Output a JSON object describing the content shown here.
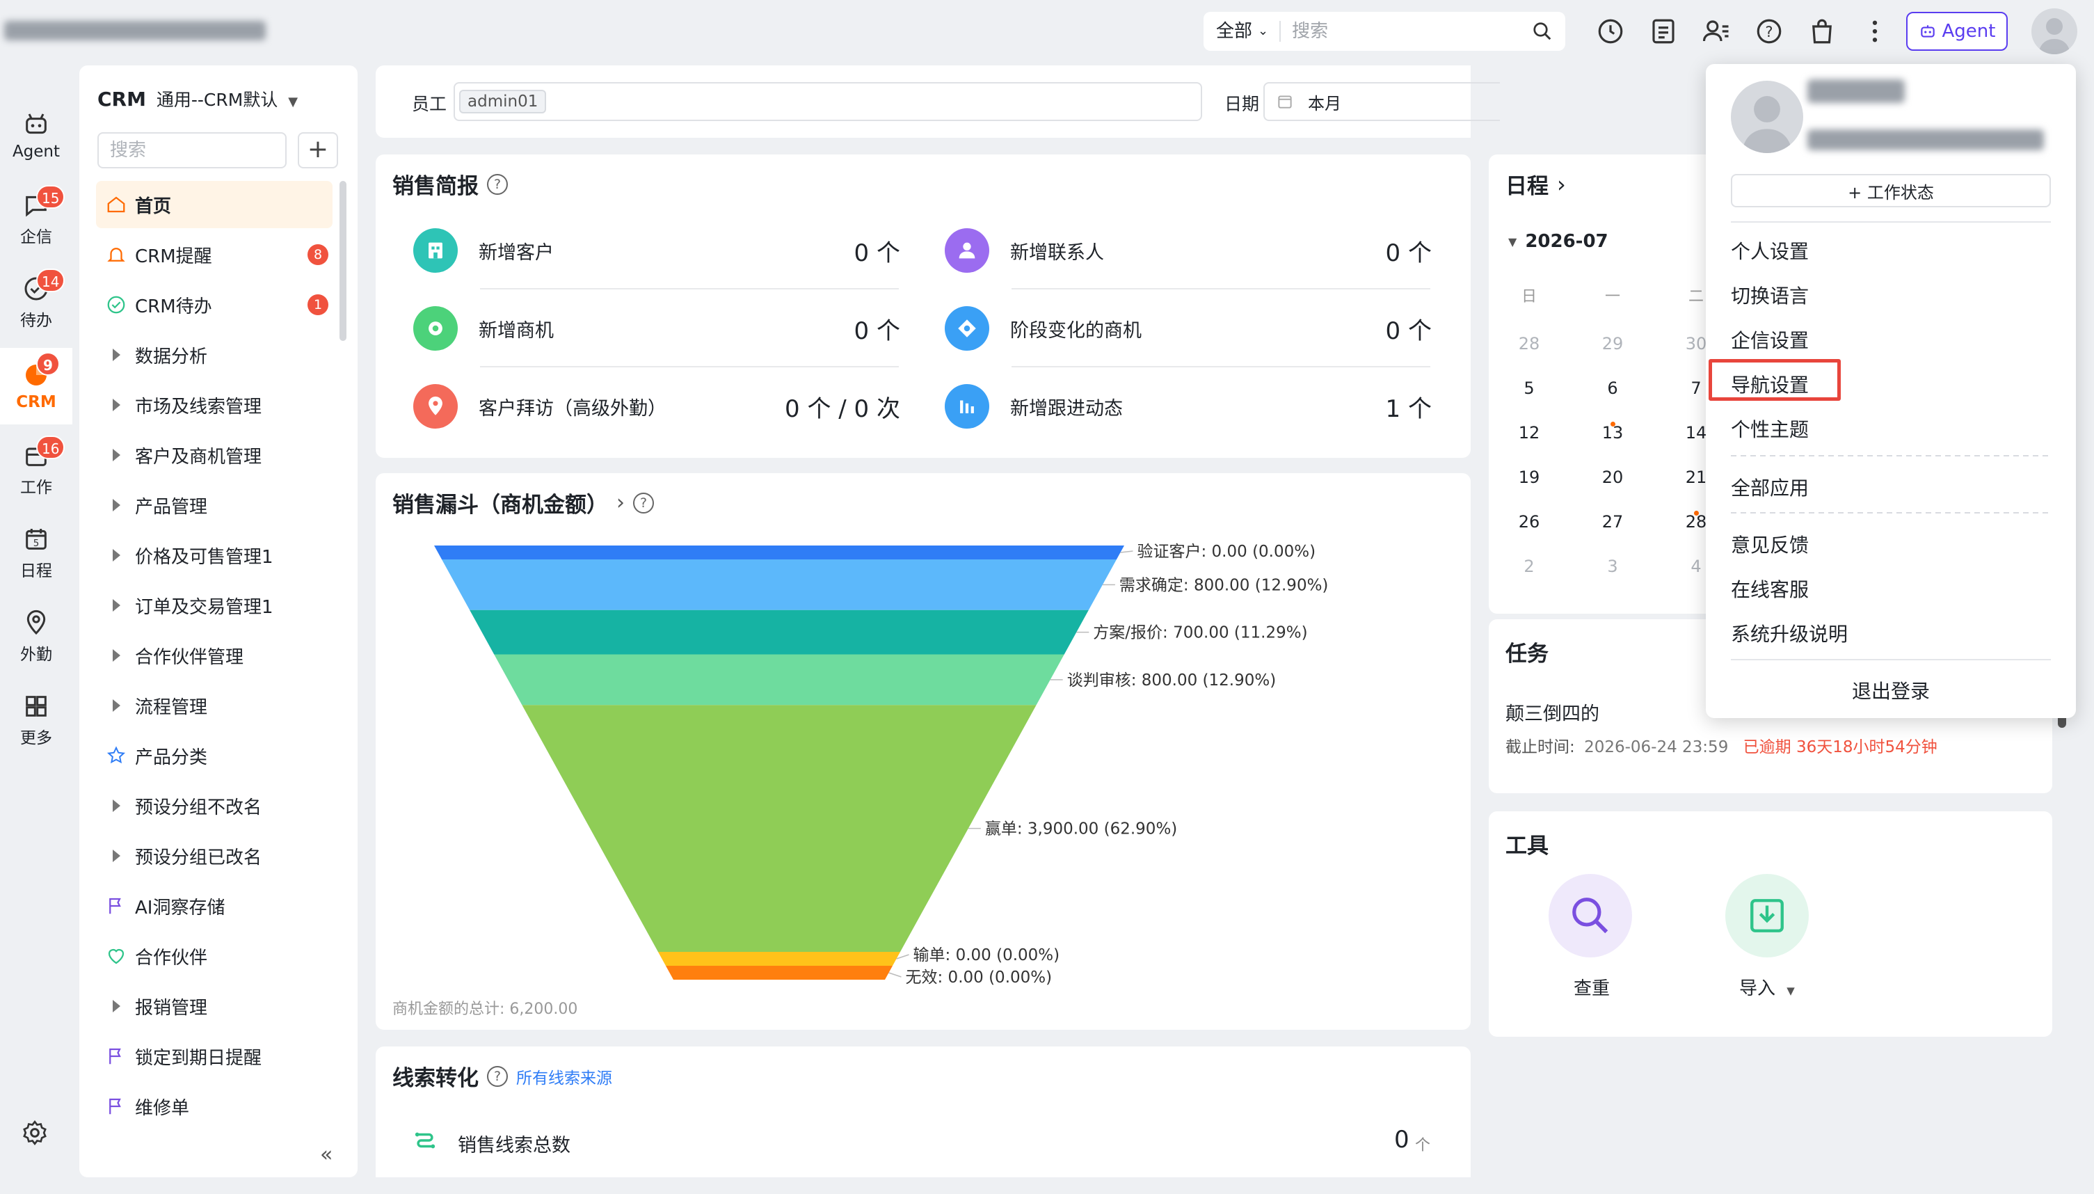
{
  "topbar": {
    "brand": "企业CRM",
    "search_scope": "全部",
    "search_placeholder": "搜索",
    "agent_label": "Agent",
    "icons": [
      "clock-icon",
      "report-icon",
      "contacts-icon",
      "help-icon",
      "bag-icon",
      "more-icon"
    ]
  },
  "rail": {
    "items": [
      {
        "label": "Agent",
        "icon": "agent-icon",
        "badge": ""
      },
      {
        "label": "企信",
        "icon": "chat-icon",
        "badge": "15"
      },
      {
        "label": "待办",
        "icon": "todo-icon",
        "badge": "14"
      },
      {
        "label": "CRM",
        "icon": "crm-icon",
        "badge": "9"
      },
      {
        "label": "工作",
        "icon": "work-icon",
        "badge": "16"
      },
      {
        "label": "日程",
        "icon": "calendar-icon",
        "badge": ""
      },
      {
        "label": "外勤",
        "icon": "location-icon",
        "badge": ""
      },
      {
        "label": "更多",
        "icon": "grid-icon",
        "badge": ""
      }
    ],
    "settings_icon": "gear-icon"
  },
  "sidebar": {
    "title_bold": "CRM",
    "title_rest": "通用--CRM默认",
    "search_placeholder": "搜索",
    "add_label": "+",
    "items": [
      {
        "label": "首页",
        "icon": "home-icon",
        "badge": "",
        "active": true
      },
      {
        "label": "CRM提醒",
        "icon": "bell-icon",
        "badge": "8"
      },
      {
        "label": "CRM待办",
        "icon": "check-circle-icon",
        "badge": "1"
      },
      {
        "label": "数据分析",
        "icon": "caret-right-icon"
      },
      {
        "label": "市场及线索管理",
        "icon": "caret-right-icon"
      },
      {
        "label": "客户及商机管理",
        "icon": "caret-right-icon"
      },
      {
        "label": "产品管理",
        "icon": "caret-right-icon"
      },
      {
        "label": "价格及可售管理1",
        "icon": "caret-right-icon"
      },
      {
        "label": "订单及交易管理1",
        "icon": "caret-right-icon"
      },
      {
        "label": "合作伙伴管理",
        "icon": "caret-right-icon"
      },
      {
        "label": "流程管理",
        "icon": "caret-right-icon"
      },
      {
        "label": "产品分类",
        "icon": "star-icon"
      },
      {
        "label": "预设分组不改名",
        "icon": "caret-right-icon"
      },
      {
        "label": "预设分组已改名",
        "icon": "caret-right-icon"
      },
      {
        "label": "AI洞察存储",
        "icon": "flag-icon"
      },
      {
        "label": "合作伙伴",
        "icon": "heart-icon"
      },
      {
        "label": "报销管理",
        "icon": "caret-right-icon"
      },
      {
        "label": "锁定到期日提醒",
        "icon": "flag-icon"
      },
      {
        "label": "维修单",
        "icon": "flag-icon"
      }
    ],
    "collapse_icon": "double-chevron-left-icon"
  },
  "filter": {
    "employee_label": "员工",
    "employee_tag": "admin01",
    "date_label": "日期",
    "date_value": "本月"
  },
  "sales_brief": {
    "title": "销售简报",
    "items": [
      {
        "label": "新增客户",
        "value": "0 个",
        "color": "#2ec4b6",
        "icon": "building-icon"
      },
      {
        "label": "新增联系人",
        "value": "0 个",
        "color": "#9b6cf0",
        "icon": "person-icon"
      },
      {
        "label": "新增商机",
        "value": "0 个",
        "color": "#4cd27a",
        "icon": "target-icon"
      },
      {
        "label": "阶段变化的商机",
        "value": "0 个",
        "color": "#3aa0f5",
        "icon": "stage-icon"
      },
      {
        "label": "客户拜访（高级外勤）",
        "value": "0 个 / 0 次",
        "color": "#f46a5a",
        "icon": "pin-icon"
      },
      {
        "label": "新增跟进动态",
        "value": "1 个",
        "color": "#3aa0f5",
        "icon": "bars-icon"
      }
    ]
  },
  "funnel": {
    "title": "销售漏斗（商机金额）",
    "total_text": "商机金额的总计: 6,200.00",
    "stages": [
      {
        "label": "验证客户: 0.00 (0.00%)",
        "color": "#2f7df6"
      },
      {
        "label": "需求确定: 800.00 (12.90%)",
        "color": "#5cb8fb"
      },
      {
        "label": "方案/报价: 700.00 (11.29%)",
        "color": "#16b3a3"
      },
      {
        "label": "谈判审核: 800.00 (12.90%)",
        "color": "#6edc9e"
      },
      {
        "label": "赢单: 3,900.00 (62.90%)",
        "color": "#8fcd56"
      },
      {
        "label": "输单: 0.00 (0.00%)",
        "color": "#ffc21a"
      },
      {
        "label": "无效: 0.00 (0.00%)",
        "color": "#ff7f0e"
      }
    ]
  },
  "chart_data": {
    "type": "funnel",
    "title": "销售漏斗（商机金额）",
    "categories": [
      "验证客户",
      "需求确定",
      "方案/报价",
      "谈判审核",
      "赢单",
      "输单",
      "无效"
    ],
    "values": [
      0,
      800,
      700,
      800,
      3900,
      0,
      0
    ],
    "percent": [
      0.0,
      12.9,
      11.29,
      12.9,
      62.9,
      0.0,
      0.0
    ],
    "total": 6200
  },
  "lead_conversion": {
    "title": "线索转化",
    "link": "所有线索来源",
    "metric_label": "销售线索总数",
    "metric_value": "0",
    "metric_unit": "个"
  },
  "schedule": {
    "title": "日程",
    "month": "2026-07",
    "weekdays": [
      "日",
      "一",
      "二"
    ],
    "rows": [
      [
        "28",
        "29",
        "30"
      ],
      [
        "5",
        "6",
        "7"
      ],
      [
        "12",
        "13",
        "14"
      ],
      [
        "19",
        "20",
        "21"
      ],
      [
        "26",
        "27",
        "28"
      ],
      [
        "2",
        "3",
        "4"
      ]
    ]
  },
  "tasks": {
    "title": "任务",
    "task_name": "颠三倒四的",
    "deadline_label": "截止时间:",
    "deadline": "2026-06-24 23:59",
    "overdue": "已逾期 36天18小时54分钟"
  },
  "tools": {
    "title": "工具",
    "items": [
      {
        "label": "查重",
        "icon": "search-icon"
      },
      {
        "label": "导入",
        "icon": "import-icon"
      }
    ]
  },
  "user_menu": {
    "status_button": "+ 工作状态",
    "items": [
      "个人设置",
      "切换语言",
      "企信设置",
      "导航设置",
      "个性主题",
      "全部应用",
      "意见反馈",
      "在线客服",
      "系统升级说明"
    ],
    "logout": "退出登录",
    "highlighted": "导航设置"
  },
  "colors": {
    "accent": "#ff6a00",
    "badge": "#f0523e",
    "agent": "#5a3df0",
    "overdue": "#f0523e",
    "highlight_box": "#e8453c"
  }
}
